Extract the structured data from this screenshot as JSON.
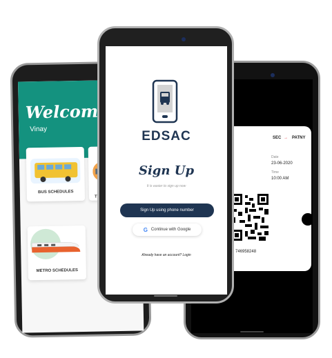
{
  "left_phone": {
    "welcome_title": "Welcome,",
    "username": "Vinay",
    "cards": [
      {
        "label": "BUS SCHEDULES"
      },
      {
        "label": "TR"
      },
      {
        "label": "METRO SCHEDULES"
      }
    ]
  },
  "center_phone": {
    "brand": "EDSAC",
    "signup_title": "Sign Up",
    "signup_subtitle": "It is easier to sign up now",
    "phone_button_label": "Sign Up using phone number",
    "google_button_label": "Continue with Google",
    "google_icon_letter": "G",
    "login_prompt": "Already have an account? Login"
  },
  "right_phone": {
    "ticket": {
      "from": "SEC",
      "arrow": "→",
      "to": "PATNY",
      "date_label": "Date",
      "date_value": "23-06-2020",
      "time_label": "Time",
      "time_value": "10:00 AM",
      "ticket_number": "746958248"
    }
  },
  "colors": {
    "teal": "#14927f",
    "navy": "#1f3552",
    "arrow_red": "#e0323a"
  }
}
